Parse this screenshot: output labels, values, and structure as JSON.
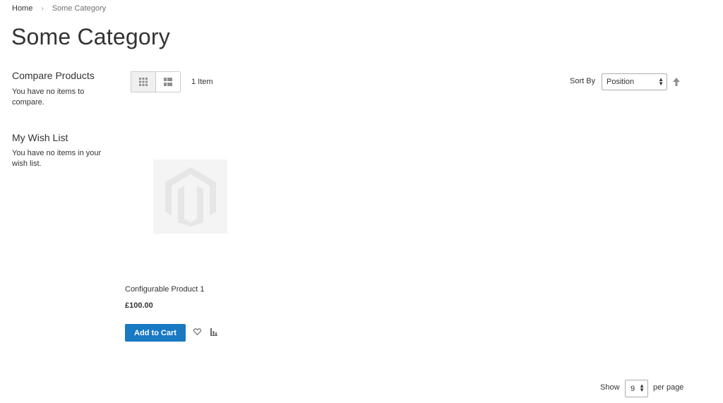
{
  "breadcrumb": {
    "home": "Home",
    "separator": "›",
    "current": "Some Category"
  },
  "page_title": "Some Category",
  "sidebar": {
    "compare": {
      "title": "Compare Products",
      "empty_text": "You have no items to compare."
    },
    "wishlist": {
      "title": "My Wish List",
      "empty_text": "You have no items in your wish list."
    }
  },
  "toolbar": {
    "view_modes": [
      "grid",
      "list"
    ],
    "active_mode": "grid",
    "item_count": "1 Item",
    "sort_label": "Sort By",
    "sort_value": "Position",
    "sort_direction_icon": "arrow-up-icon"
  },
  "products": [
    {
      "name": "Configurable Product 1",
      "price": "£100.00",
      "add_to_cart_label": "Add to Cart",
      "image_icon": "magento-placeholder-icon",
      "wishlist_icon": "heart-icon",
      "compare_icon": "bar-chart-icon"
    }
  ],
  "limiter": {
    "show_label": "Show",
    "value": "9",
    "per_page_label": "per page"
  },
  "colors": {
    "primary_button": "#1979c3",
    "text": "#333333",
    "muted_text": "#707070",
    "placeholder_bg": "#f4f4f4"
  }
}
